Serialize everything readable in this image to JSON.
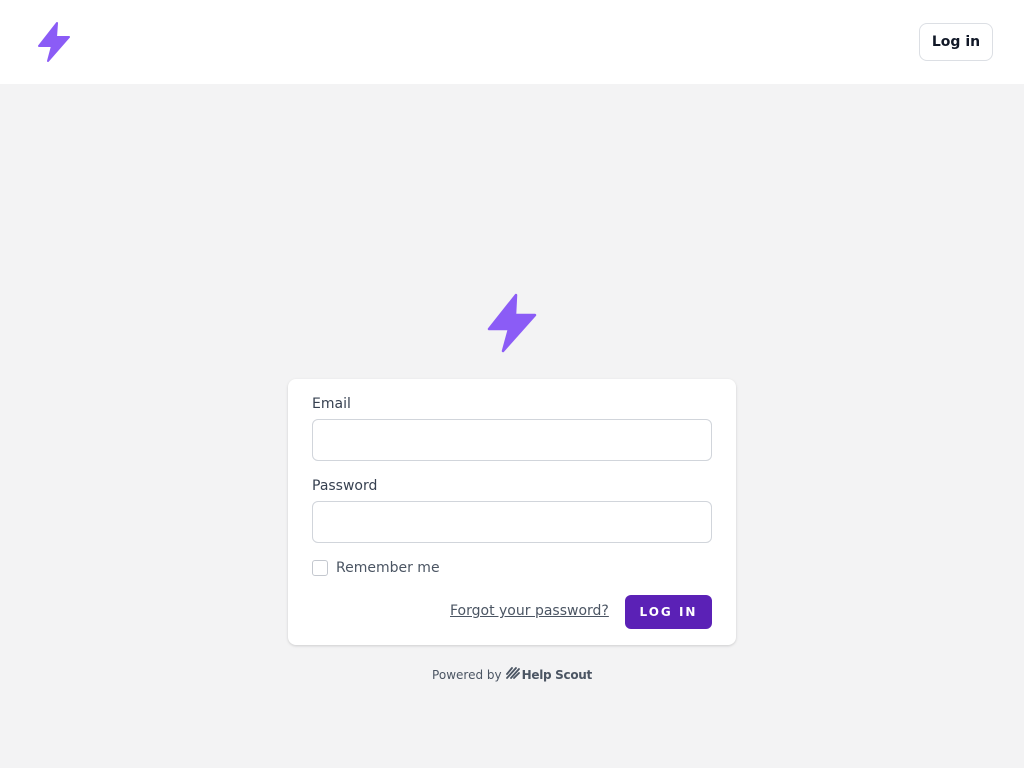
{
  "brand": {
    "accent_color": "#8b5cf6",
    "logo_icon": "lightning-bolt-icon"
  },
  "header": {
    "login_button_label": "Log in"
  },
  "form": {
    "email_label": "Email",
    "email_value": "",
    "password_label": "Password",
    "password_value": "",
    "remember_label": "Remember me",
    "remember_checked": false,
    "forgot_link": "Forgot your password?",
    "submit_label": "LOG IN",
    "submit_color": "#5b21b6"
  },
  "footer": {
    "powered_by": "Powered by",
    "provider_name": "Help Scout",
    "provider_icon": "help-scout-logo-icon"
  }
}
